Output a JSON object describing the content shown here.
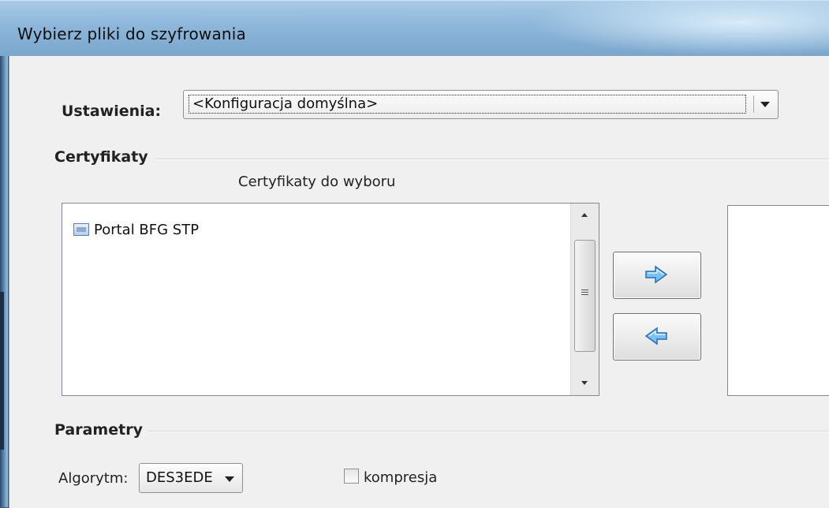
{
  "window": {
    "title": "Wybierz pliki do szyfrowania"
  },
  "settings": {
    "label": "Ustawienia:",
    "selected": "<Konfiguracja domyślna>"
  },
  "certificates": {
    "group_title": "Certyfikaty",
    "available_caption": "Certyfikaty do wyboru",
    "available_items": [
      {
        "label": "Portal BFG STP",
        "icon": "certificate-icon"
      }
    ],
    "add_button_icon": "arrow-right-icon",
    "remove_button_icon": "arrow-left-icon"
  },
  "parameters": {
    "group_title": "Parametry",
    "algorithm_label": "Algorytm:",
    "algorithm_value": "DES3EDE",
    "compression_label": "kompresja",
    "compression_checked": false
  },
  "colors": {
    "arrow_blue": "#3b8fd9",
    "titlebar": "#8fb8db"
  }
}
